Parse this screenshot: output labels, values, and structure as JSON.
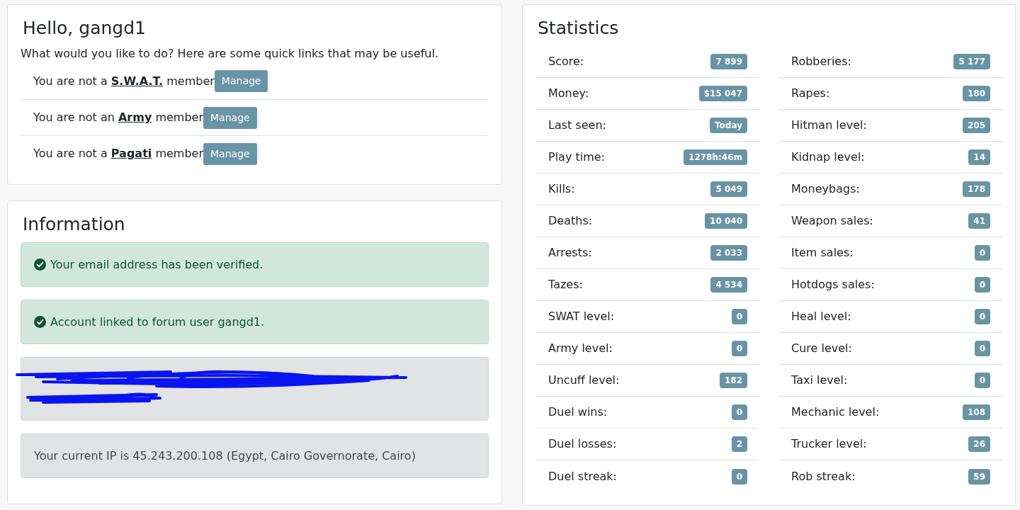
{
  "greeting": {
    "title": "Hello, gangd1",
    "intro": "What would you like to do? Here are some quick links that may be useful.",
    "memberships": [
      {
        "prefix": "You are not a",
        "group": "S.W.A.T.",
        "suffix": "member",
        "button": "Manage"
      },
      {
        "prefix": "You are not an",
        "group": "Army",
        "suffix": "member",
        "button": "Manage"
      },
      {
        "prefix": "You are not a",
        "group": "Pagati",
        "suffix": "member",
        "button": "Manage"
      }
    ]
  },
  "information": {
    "title": "Information",
    "alerts": [
      {
        "kind": "success",
        "text": "Your email address has been verified."
      },
      {
        "kind": "success",
        "text": "Account linked to forum user gangd1."
      },
      {
        "kind": "redacted"
      },
      {
        "kind": "secondary",
        "text": "Your current IP is 45.243.200.108 (Egypt, Cairo Governorate, Cairo)"
      }
    ]
  },
  "statistics": {
    "title": "Statistics",
    "columns": [
      [
        {
          "label": "Score:",
          "value": "7 899"
        },
        {
          "label": "Money:",
          "value": "$15 047"
        },
        {
          "label": "Last seen:",
          "value": "Today"
        },
        {
          "label": "Play time:",
          "value": "1278h:46m"
        },
        {
          "label": "Kills:",
          "value": "5 049"
        },
        {
          "label": "Deaths:",
          "value": "10 040"
        },
        {
          "label": "Arrests:",
          "value": "2 033"
        },
        {
          "label": "Tazes:",
          "value": "4 534"
        },
        {
          "label": "SWAT level:",
          "value": "0"
        },
        {
          "label": "Army level:",
          "value": "0"
        },
        {
          "label": "Uncuff level:",
          "value": "182"
        },
        {
          "label": "Duel wins:",
          "value": "0"
        },
        {
          "label": "Duel losses:",
          "value": "2"
        },
        {
          "label": "Duel streak:",
          "value": "0"
        }
      ],
      [
        {
          "label": "Robberies:",
          "value": "5 177"
        },
        {
          "label": "Rapes:",
          "value": "180"
        },
        {
          "label": "Hitman level:",
          "value": "205"
        },
        {
          "label": "Kidnap level:",
          "value": "14"
        },
        {
          "label": "Moneybags:",
          "value": "178"
        },
        {
          "label": "Weapon sales:",
          "value": "41"
        },
        {
          "label": "Item sales:",
          "value": "0"
        },
        {
          "label": "Hotdogs sales:",
          "value": "0"
        },
        {
          "label": "Heal level:",
          "value": "0"
        },
        {
          "label": "Cure level:",
          "value": "0"
        },
        {
          "label": "Taxi level:",
          "value": "0"
        },
        {
          "label": "Mechanic level:",
          "value": "108"
        },
        {
          "label": "Trucker level:",
          "value": "26"
        },
        {
          "label": "Rob streak:",
          "value": "59"
        }
      ]
    ]
  }
}
